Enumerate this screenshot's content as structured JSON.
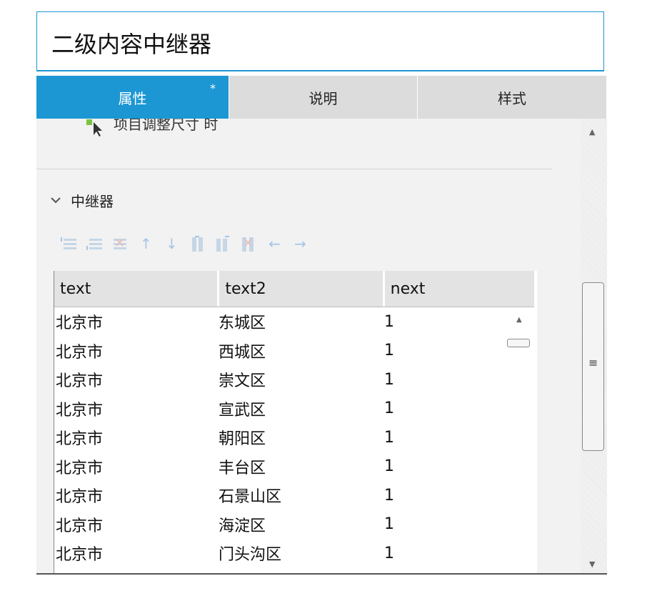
{
  "title": "二级内容中继器",
  "tabs": [
    {
      "label": "属性",
      "active": true,
      "modified": "*"
    },
    {
      "label": "说明",
      "active": false
    },
    {
      "label": "样式",
      "active": false
    }
  ],
  "event_item": {
    "label": "项目调整尺寸 时",
    "icon": "cursor-action-icon"
  },
  "section": {
    "label": "中继器",
    "expanded": true
  },
  "toolbar": [
    "insert-row-above-icon",
    "insert-row-below-icon",
    "delete-row-icon",
    "move-up-icon",
    "move-down-icon",
    "insert-column-left-icon",
    "insert-column-right-icon",
    "delete-column-icon",
    "move-left-icon",
    "move-right-icon"
  ],
  "table": {
    "columns": [
      "text",
      "text2",
      "next"
    ],
    "rows": [
      [
        "北京市",
        "东城区",
        "1"
      ],
      [
        "北京市",
        "西城区",
        "1"
      ],
      [
        "北京市",
        "崇文区",
        "1"
      ],
      [
        "北京市",
        "宣武区",
        "1"
      ],
      [
        "北京市",
        "朝阳区",
        "1"
      ],
      [
        "北京市",
        "丰台区",
        "1"
      ],
      [
        "北京市",
        "石景山区",
        "1"
      ],
      [
        "北京市",
        "海淀区",
        "1"
      ],
      [
        "北京市",
        "门头沟区",
        "1"
      ]
    ]
  },
  "colors": {
    "accent": "#1c97d3",
    "tab_inactive": "#dcdcdc",
    "panel_bg": "#f2f2f2"
  }
}
